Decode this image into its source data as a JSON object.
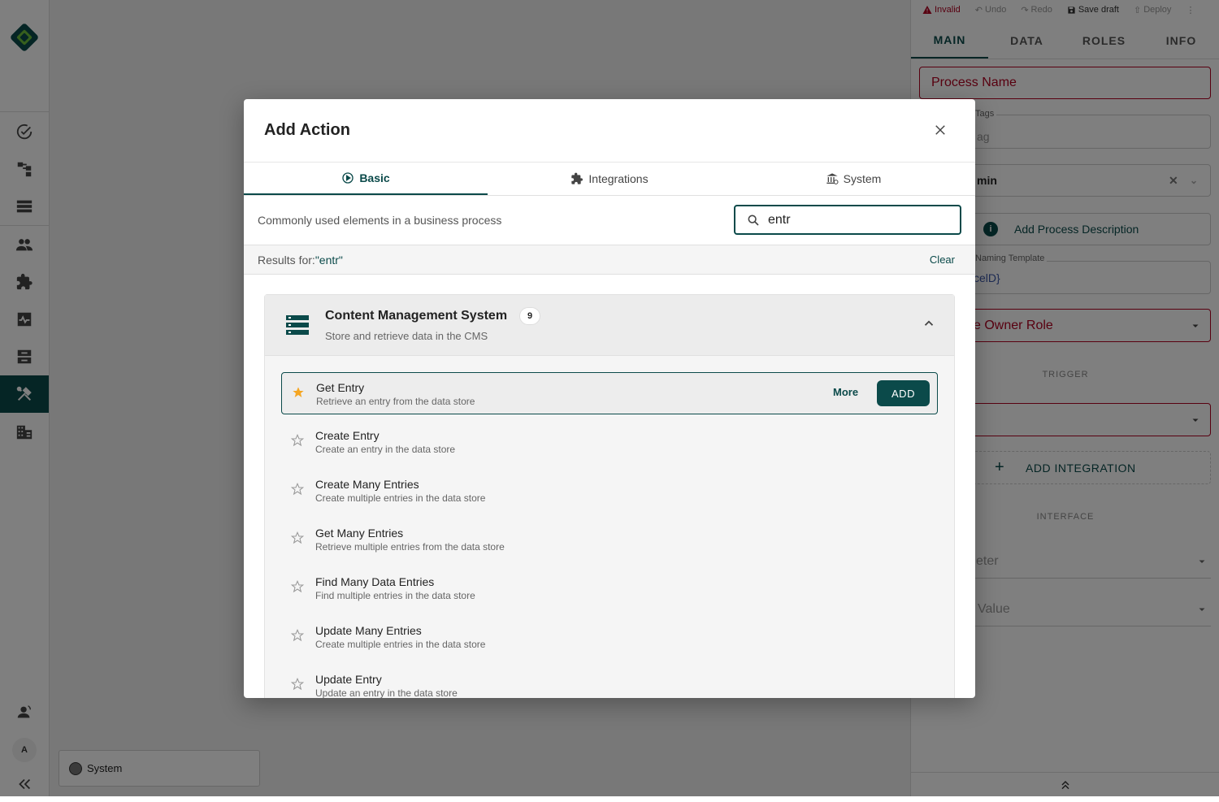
{
  "sidebar": {
    "nav": [
      {
        "name": "tasks",
        "icon": "check-circle-icon"
      },
      {
        "name": "processes",
        "icon": "flow-icon"
      },
      {
        "name": "lists",
        "icon": "list-icon"
      },
      {
        "name": "users",
        "icon": "people-icon"
      },
      {
        "name": "integrations",
        "icon": "puzzle-icon"
      },
      {
        "name": "monitor",
        "icon": "pulse-icon"
      },
      {
        "name": "inbox",
        "icon": "inbox-icon"
      },
      {
        "name": "builder",
        "icon": "tools-icon"
      },
      {
        "name": "organization",
        "icon": "building-icon"
      }
    ],
    "avatar_letter": "A"
  },
  "canvas": {
    "system_chip": "System"
  },
  "panel": {
    "toolbar": {
      "invalid": "Invalid",
      "undo": "Undo",
      "redo": "Redo",
      "save": "Save draft",
      "deploy": "Deploy"
    },
    "tabs": [
      "MAIN",
      "DATA",
      "ROLES",
      "INFO"
    ],
    "process_name": "Process Name",
    "tags_label": "Tags",
    "tags_placeholder": "ag",
    "role_value": "min",
    "description_btn": "Add Process Description",
    "naming_label": "Naming Template",
    "naming_value": "celD}",
    "owner_role": "e Owner Role",
    "trigger_label": "TRIGGER",
    "add_integration": "ADD INTEGRATION",
    "interface_label": "INTERFACE",
    "parameter": "eter",
    "value": "Value"
  },
  "modal": {
    "title": "Add Action",
    "tabs": [
      {
        "label": "Basic",
        "icon": "play-circle-icon"
      },
      {
        "label": "Integrations",
        "icon": "puzzle-icon"
      },
      {
        "label": "System",
        "icon": "bank-icon"
      }
    ],
    "description": "Commonly used elements in a business process",
    "search_value": "entr",
    "results_prefix": "Results for: ",
    "results_query": "\"entr\"",
    "clear": "Clear",
    "group": {
      "title": "Content Management System",
      "count": "9",
      "subtitle": "Store and retrieve data in the CMS",
      "items": [
        {
          "title": "Get Entry",
          "subtitle": "Retrieve an entry from the data store",
          "starred": true
        },
        {
          "title": "Create Entry",
          "subtitle": "Create an entry in the data store",
          "starred": false
        },
        {
          "title": "Create Many Entries",
          "subtitle": "Create multiple entries in the data store",
          "starred": false
        },
        {
          "title": "Get Many Entries",
          "subtitle": "Retrieve multiple entries from the data store",
          "starred": false
        },
        {
          "title": "Find Many Data Entries",
          "subtitle": "Find multiple entries in the data store",
          "starred": false
        },
        {
          "title": "Update Many Entries",
          "subtitle": "Create multiple entries in the data store",
          "starred": false
        },
        {
          "title": "Update Entry",
          "subtitle": "Update an entry in the data store",
          "starred": false
        }
      ],
      "more_label": "More",
      "add_label": "ADD"
    }
  },
  "colors": {
    "accent": "#0b4a4a",
    "error": "#b00020",
    "star": "#f5a623"
  }
}
